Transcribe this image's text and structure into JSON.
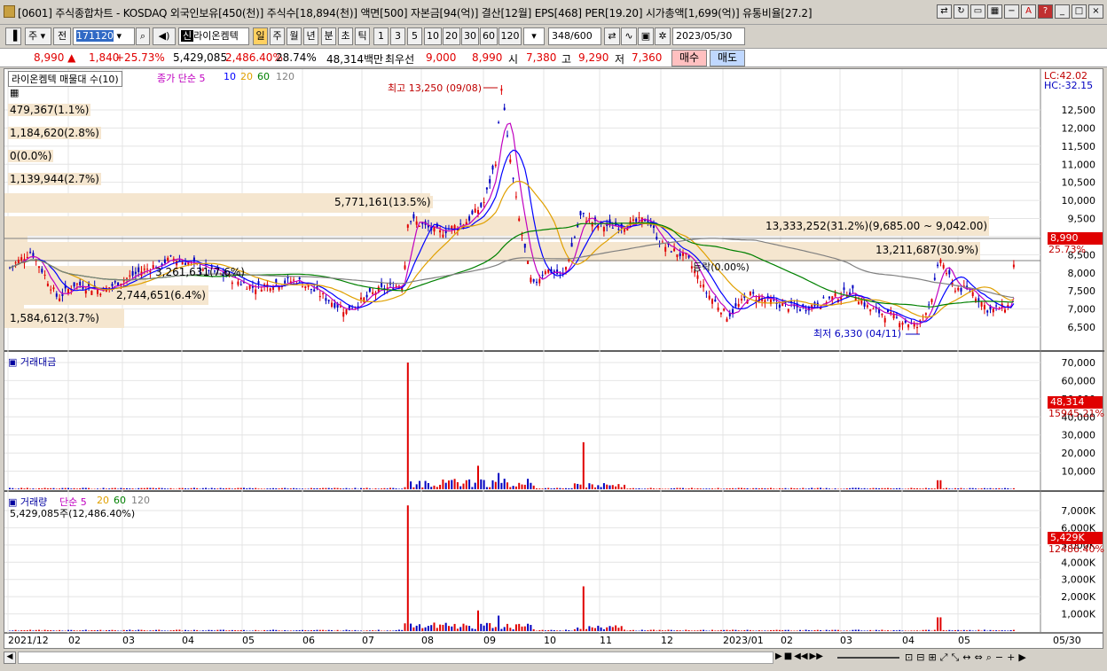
{
  "window": {
    "title": "[0601] 주식종합차트 - KOSDAQ 외국인보유[450(천)] 주식수[18,894(천)] 액면[500] 자본금[94(억)] 결산[12월] EPS[468] PER[19.20] 시가총액[1,699(억)] 유통비율[27.2]",
    "buttons": [
      "?",
      "A",
      "_",
      "□",
      "×"
    ]
  },
  "toolbar": {
    "period_select": "주",
    "prev_label": "전",
    "code_value": "171120",
    "stock_name": "라이온켐텍",
    "period_tabs": [
      "일",
      "주",
      "월",
      "년",
      "분",
      "초",
      "틱"
    ],
    "interval_tabs": [
      "1",
      "3",
      "5",
      "10",
      "20",
      "30",
      "60",
      "120"
    ],
    "count_value": "348",
    "count_total": "/600",
    "date_value": "2023/05/30"
  },
  "quote": {
    "price": "8,990",
    "change": "1,840",
    "change_pct": "+25.73%",
    "volume": "5,429,085",
    "volume_pct": "2,486.40%",
    "turnover": "28.74%",
    "amount": "48,314백만",
    "best_bid_label": "최우선",
    "best_bid": "9,000",
    "best_ask": "8,990",
    "open_label": "시",
    "open": "7,380",
    "high_label": "고",
    "high": "9,290",
    "low_label": "저",
    "low": "7,360",
    "buy_label": "매수",
    "sell_label": "매도"
  },
  "price_panel": {
    "legend_name": "라이온켐텍 매물대 수(10)",
    "legend_ma": "종가 단순 5",
    "ma_labels": [
      "10",
      "20",
      "60",
      "120"
    ],
    "ma_colors": [
      "#c000c0",
      "#0000ff",
      "#e0a000",
      "#008000",
      "#808080"
    ],
    "lc": "LC:42.02",
    "hc": "HC:-32.15",
    "current_price_tag": "8,990",
    "current_pct_tag": "25.73%",
    "high_note": "최고 13,250 (09/08)",
    "low_note": "최저 6,330 (04/11)",
    "pct_note": "등락(0.00%)",
    "volume_profile": [
      "479,367(1.1%)",
      "1,184,620(2.8%)",
      "0(0.0%)",
      "1,139,944(2.7%)",
      "5,771,161(13.5%)",
      "13,333,252(31.2%)(9,685.00 ~ 9,042.00)",
      "13,211,687(30.9%)",
      "3,261,631(7.6%)",
      "2,744,651(6.4%)",
      "1,584,612(3.7%)"
    ],
    "y_ticks": [
      "12,500",
      "12,000",
      "11,500",
      "11,000",
      "10,500",
      "10,000",
      "9,500",
      "9,000",
      "8,500",
      "8,000",
      "7,500",
      "7,000",
      "6,500"
    ]
  },
  "amount_panel": {
    "legend": "거래대금",
    "tag_value": "48,314",
    "tag_pct": "15945.21%",
    "y_ticks": [
      "70,000",
      "60,000",
      "50,000",
      "40,000",
      "30,000",
      "20,000",
      "10,000"
    ]
  },
  "volume_panel": {
    "legend": "거래량",
    "legend_ma": "단순 5",
    "ma_labels": [
      "20",
      "60",
      "120"
    ],
    "current": "5,429,085주(12,486.40%)",
    "tag_value": "5,429K",
    "tag_pct": "12486.40%",
    "y_ticks": [
      "7,000K",
      "6,000K",
      "5,000K",
      "4,000K",
      "3,000K",
      "2,000K",
      "1,000K"
    ]
  },
  "x_axis": [
    "2021/12",
    "02",
    "03",
    "04",
    "05",
    "06",
    "07",
    "08",
    "09",
    "10",
    "11",
    "12",
    "2023/01",
    "02",
    "03",
    "04",
    "05",
    "05/30"
  ],
  "colors": {
    "up": "#e00000",
    "down": "#0000c0",
    "profile": "#f5e6cf"
  }
}
